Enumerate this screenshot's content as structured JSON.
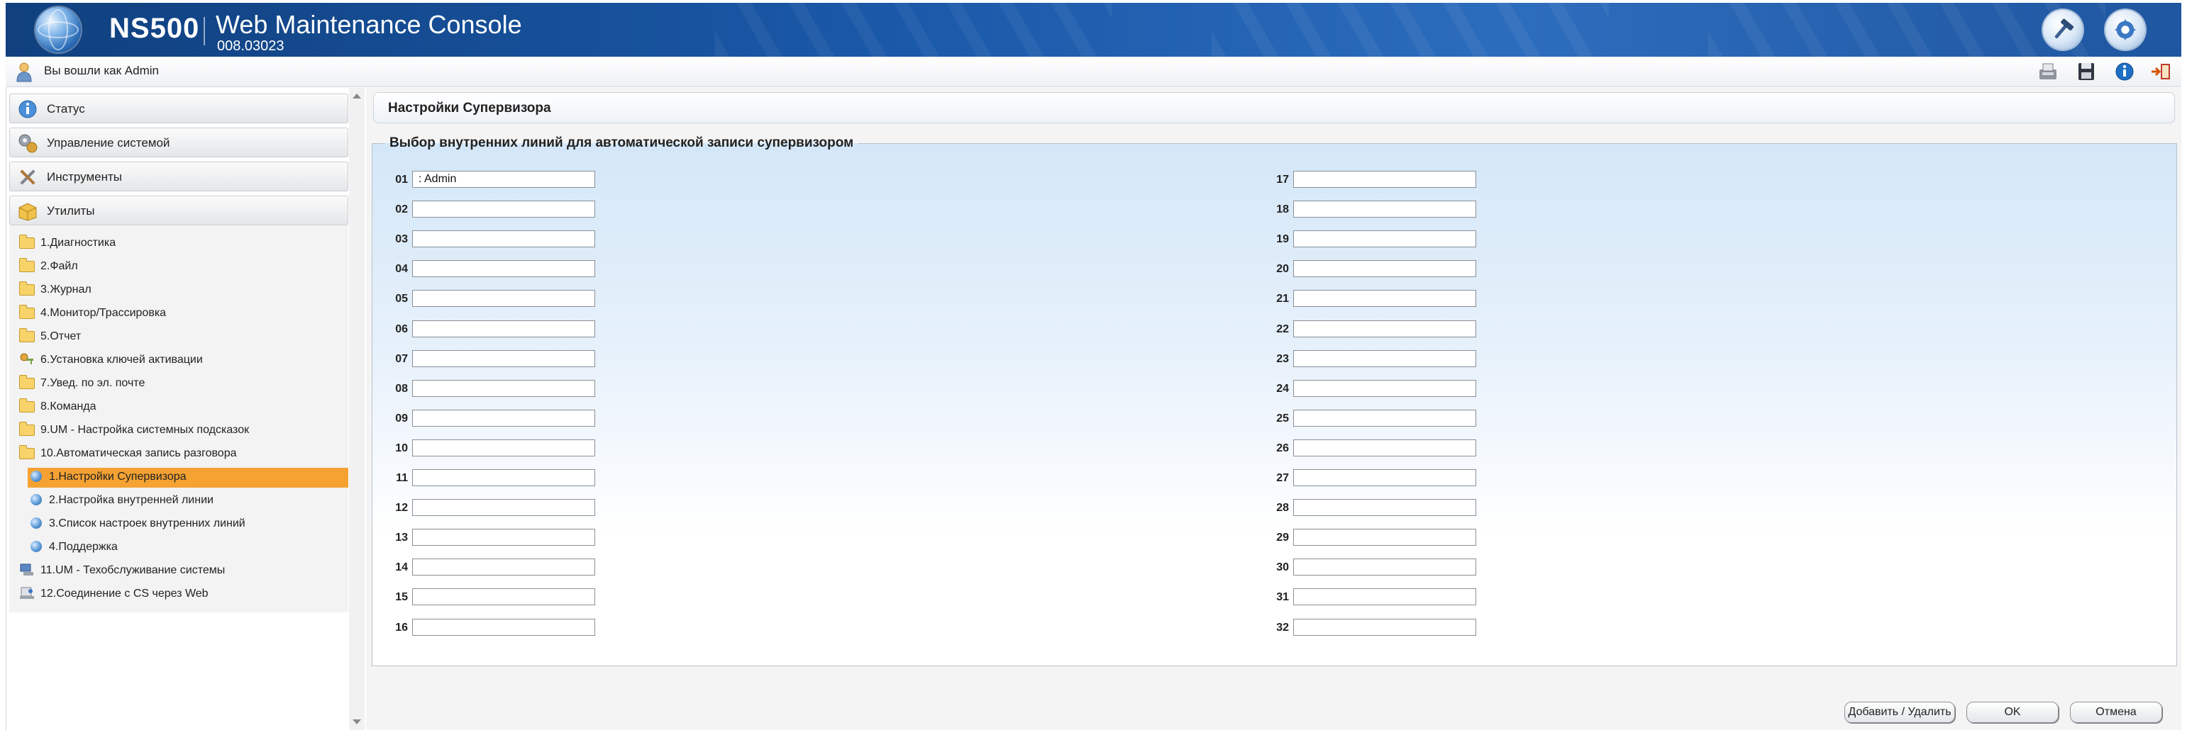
{
  "header": {
    "model": "NS500",
    "title": "Web Maintenance Console",
    "version": "008.03023"
  },
  "userbar": {
    "logged_in_text": "Вы вошли как Admin"
  },
  "sidebar": {
    "sections": [
      {
        "label": "Статус",
        "icon": "status-info-icon"
      },
      {
        "label": "Управление системой",
        "icon": "system-management-icon"
      },
      {
        "label": "Инструменты",
        "icon": "tools-icon"
      },
      {
        "label": "Утилиты",
        "icon": "utilities-box-icon"
      }
    ],
    "tree": [
      {
        "label": "1.Диагностика",
        "icon": "folder-icon"
      },
      {
        "label": "2.Файл",
        "icon": "folder-icon"
      },
      {
        "label": "3.Журнал",
        "icon": "folder-icon"
      },
      {
        "label": "4.Монитор/Трассировка",
        "icon": "folder-icon"
      },
      {
        "label": "5.Отчет",
        "icon": "folder-icon"
      },
      {
        "label": "6.Установка ключей активации",
        "icon": "activation-key-icon"
      },
      {
        "label": "7.Увед. по эл. почте",
        "icon": "folder-icon"
      },
      {
        "label": "8.Команда",
        "icon": "folder-icon"
      },
      {
        "label": "9.UM - Настройка системных подсказок",
        "icon": "folder-icon"
      },
      {
        "label": "10.Автоматическая запись разговора",
        "icon": "folder-open-icon"
      },
      {
        "label": "1.Настройки Супервизора",
        "icon": "bullet-icon",
        "selected": true
      },
      {
        "label": "2.Настройка внутренней линии",
        "icon": "bullet-icon"
      },
      {
        "label": "3.Список настроек внутренних линий",
        "icon": "bullet-icon"
      },
      {
        "label": "4.Поддержка",
        "icon": "bullet-icon"
      },
      {
        "label": "11.UM - Техобслуживание системы",
        "icon": "computer-icon"
      },
      {
        "label": "12.Соединение с CS через Web",
        "icon": "web-connection-icon"
      }
    ]
  },
  "main": {
    "page_title": "Настройки Супервизора",
    "group_title": "Выбор внутренних линий для автоматической записи супервизором",
    "rows": [
      {
        "num": "01",
        "value": ": Admin"
      },
      {
        "num": "02",
        "value": ""
      },
      {
        "num": "03",
        "value": ""
      },
      {
        "num": "04",
        "value": ""
      },
      {
        "num": "05",
        "value": ""
      },
      {
        "num": "06",
        "value": ""
      },
      {
        "num": "07",
        "value": ""
      },
      {
        "num": "08",
        "value": ""
      },
      {
        "num": "09",
        "value": ""
      },
      {
        "num": "10",
        "value": ""
      },
      {
        "num": "11",
        "value": ""
      },
      {
        "num": "12",
        "value": ""
      },
      {
        "num": "13",
        "value": ""
      },
      {
        "num": "14",
        "value": ""
      },
      {
        "num": "15",
        "value": ""
      },
      {
        "num": "16",
        "value": ""
      },
      {
        "num": "17",
        "value": ""
      },
      {
        "num": "18",
        "value": ""
      },
      {
        "num": "19",
        "value": ""
      },
      {
        "num": "20",
        "value": ""
      },
      {
        "num": "21",
        "value": ""
      },
      {
        "num": "22",
        "value": ""
      },
      {
        "num": "23",
        "value": ""
      },
      {
        "num": "24",
        "value": ""
      },
      {
        "num": "25",
        "value": ""
      },
      {
        "num": "26",
        "value": ""
      },
      {
        "num": "27",
        "value": ""
      },
      {
        "num": "28",
        "value": ""
      },
      {
        "num": "29",
        "value": ""
      },
      {
        "num": "30",
        "value": ""
      },
      {
        "num": "31",
        "value": ""
      },
      {
        "num": "32",
        "value": ""
      }
    ]
  },
  "buttons": {
    "add_remove": "Добавить / Удалить",
    "ok": "OK",
    "cancel": "Отмена"
  },
  "colors": {
    "header_blue": "#1a58a8",
    "selected_orange": "#f5a233"
  }
}
